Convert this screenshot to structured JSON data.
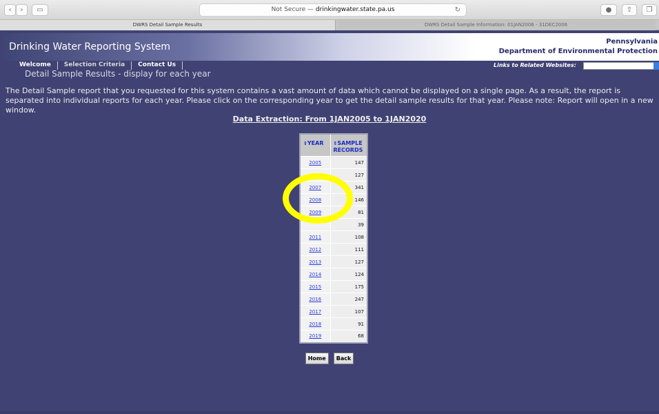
{
  "browser": {
    "address_prefix": "Not Secure — ",
    "address_host": "drinkingwater.state.pa.us",
    "tabs": [
      {
        "label": "DWRS Detail Sample Results"
      },
      {
        "label": "DWRS Detail Sample Information: 01JAN2006 - 31DEC2006"
      }
    ]
  },
  "header": {
    "system_name": "Drinking Water Reporting System",
    "dept_line1": "Pennsylvania",
    "dept_line2": "Department of Environmental Protection"
  },
  "nav": {
    "welcome": "Welcome",
    "selection_criteria": "Selection Criteria",
    "contact_us": "Contact Us"
  },
  "links_label": "Links to Related Websites:",
  "subtitle": "Detail Sample Results - display for each year",
  "intro": "The Detail Sample report that you requested for this system contains a vast amount of data which cannot be displayed on a single page. As a result, the report is separated into individual reports for each year. Please click on the corresponding year to get the detail sample results for that year. Please note: Report will open in a new window.",
  "extraction": "Data Extraction: From 1JAN2005 to 1JAN2020",
  "table": {
    "col_year": "YEAR",
    "col_records_1": "SAMPLE",
    "col_records_2": "RECORDS",
    "rows": [
      {
        "year": "2005",
        "records": "147"
      },
      {
        "year": "",
        "records": "127"
      },
      {
        "year": "2007",
        "records": "341"
      },
      {
        "year": "2008",
        "records": "146"
      },
      {
        "year": "2009",
        "records": "81"
      },
      {
        "year": "",
        "records": "39"
      },
      {
        "year": "2011",
        "records": "108"
      },
      {
        "year": "2012",
        "records": "111"
      },
      {
        "year": "2013",
        "records": "127"
      },
      {
        "year": "2014",
        "records": "124"
      },
      {
        "year": "2015",
        "records": "175"
      },
      {
        "year": "2016",
        "records": "247"
      },
      {
        "year": "2017",
        "records": "107"
      },
      {
        "year": "2018",
        "records": "91"
      },
      {
        "year": "2019",
        "records": "68"
      }
    ]
  },
  "buttons": {
    "home": "Home",
    "back": "Back"
  },
  "colors": {
    "page_background": "#3f4272",
    "annotation_circle": "#ffff00",
    "link": "#2a3bd8"
  }
}
